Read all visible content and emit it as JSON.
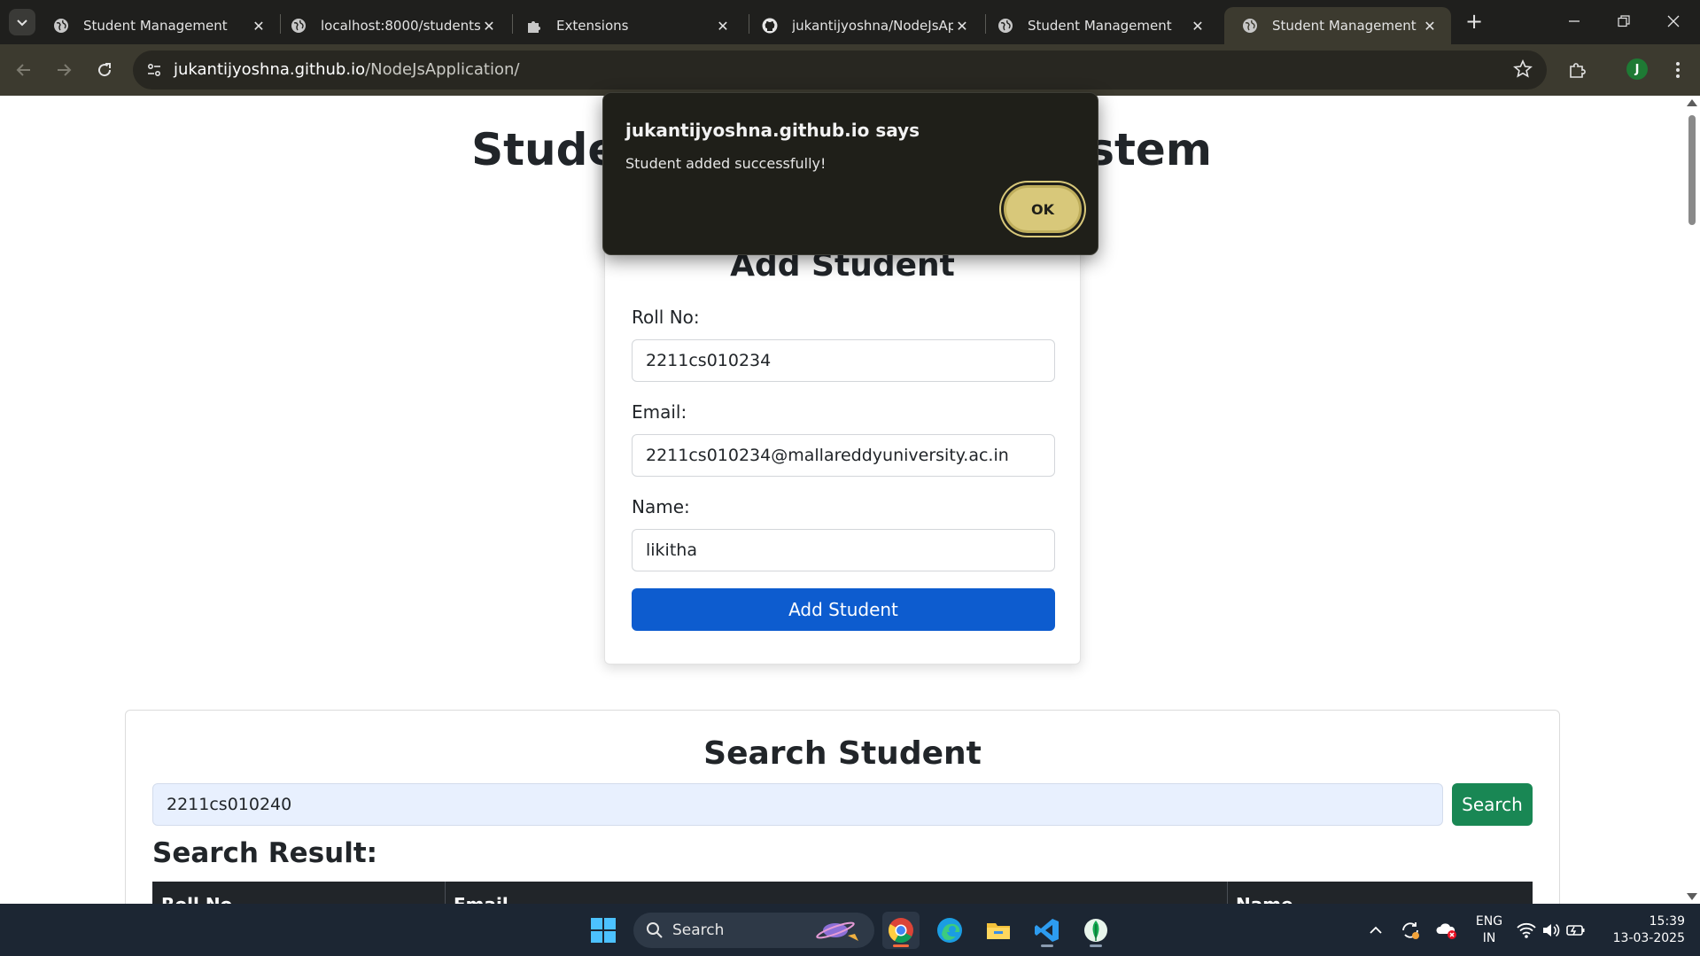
{
  "browser": {
    "tabs": [
      {
        "title": "Student Management",
        "icon": "globe-icon",
        "active": false
      },
      {
        "title": "localhost:8000/students",
        "icon": "globe-icon",
        "active": false
      },
      {
        "title": "Extensions",
        "icon": "puzzle-icon",
        "active": false
      },
      {
        "title": "jukantijyoshna/NodeJsApp",
        "icon": "github-icon",
        "active": false
      },
      {
        "title": "Student Management",
        "icon": "globe-icon",
        "active": false
      },
      {
        "title": "Student Management",
        "icon": "globe-icon",
        "active": true
      }
    ],
    "url_host": "jukantijyoshna.github.io",
    "url_path": "/NodeJsApplication/",
    "profile_initial": "J"
  },
  "page": {
    "title": "Student Management System",
    "add_form": {
      "heading": "Add Student",
      "roll_label": "Roll No:",
      "roll_value": "2211cs010234",
      "email_label": "Email:",
      "email_value": "2211cs010234@mallareddyuniversity.ac.in",
      "name_label": "Name:",
      "name_value": "likitha",
      "submit_label": "Add Student"
    },
    "search": {
      "heading": "Search Student",
      "input_value": "2211cs010240",
      "button_label": "Search",
      "result_heading": "Search Result:",
      "columns": [
        "Roll No",
        "Email",
        "Name"
      ]
    }
  },
  "dialog": {
    "title": "jukantijyoshna.github.io says",
    "message": "Student added successfully!",
    "ok_label": "OK"
  },
  "taskbar": {
    "search_placeholder": "Search",
    "lang_top": "ENG",
    "lang_bottom": "IN",
    "time": "15:39",
    "date": "13-03-2025"
  },
  "colors": {
    "primary_button": "#0d5ccf",
    "search_button": "#198754",
    "dialog_ok": "#d8c87a",
    "table_header": "#212529"
  }
}
